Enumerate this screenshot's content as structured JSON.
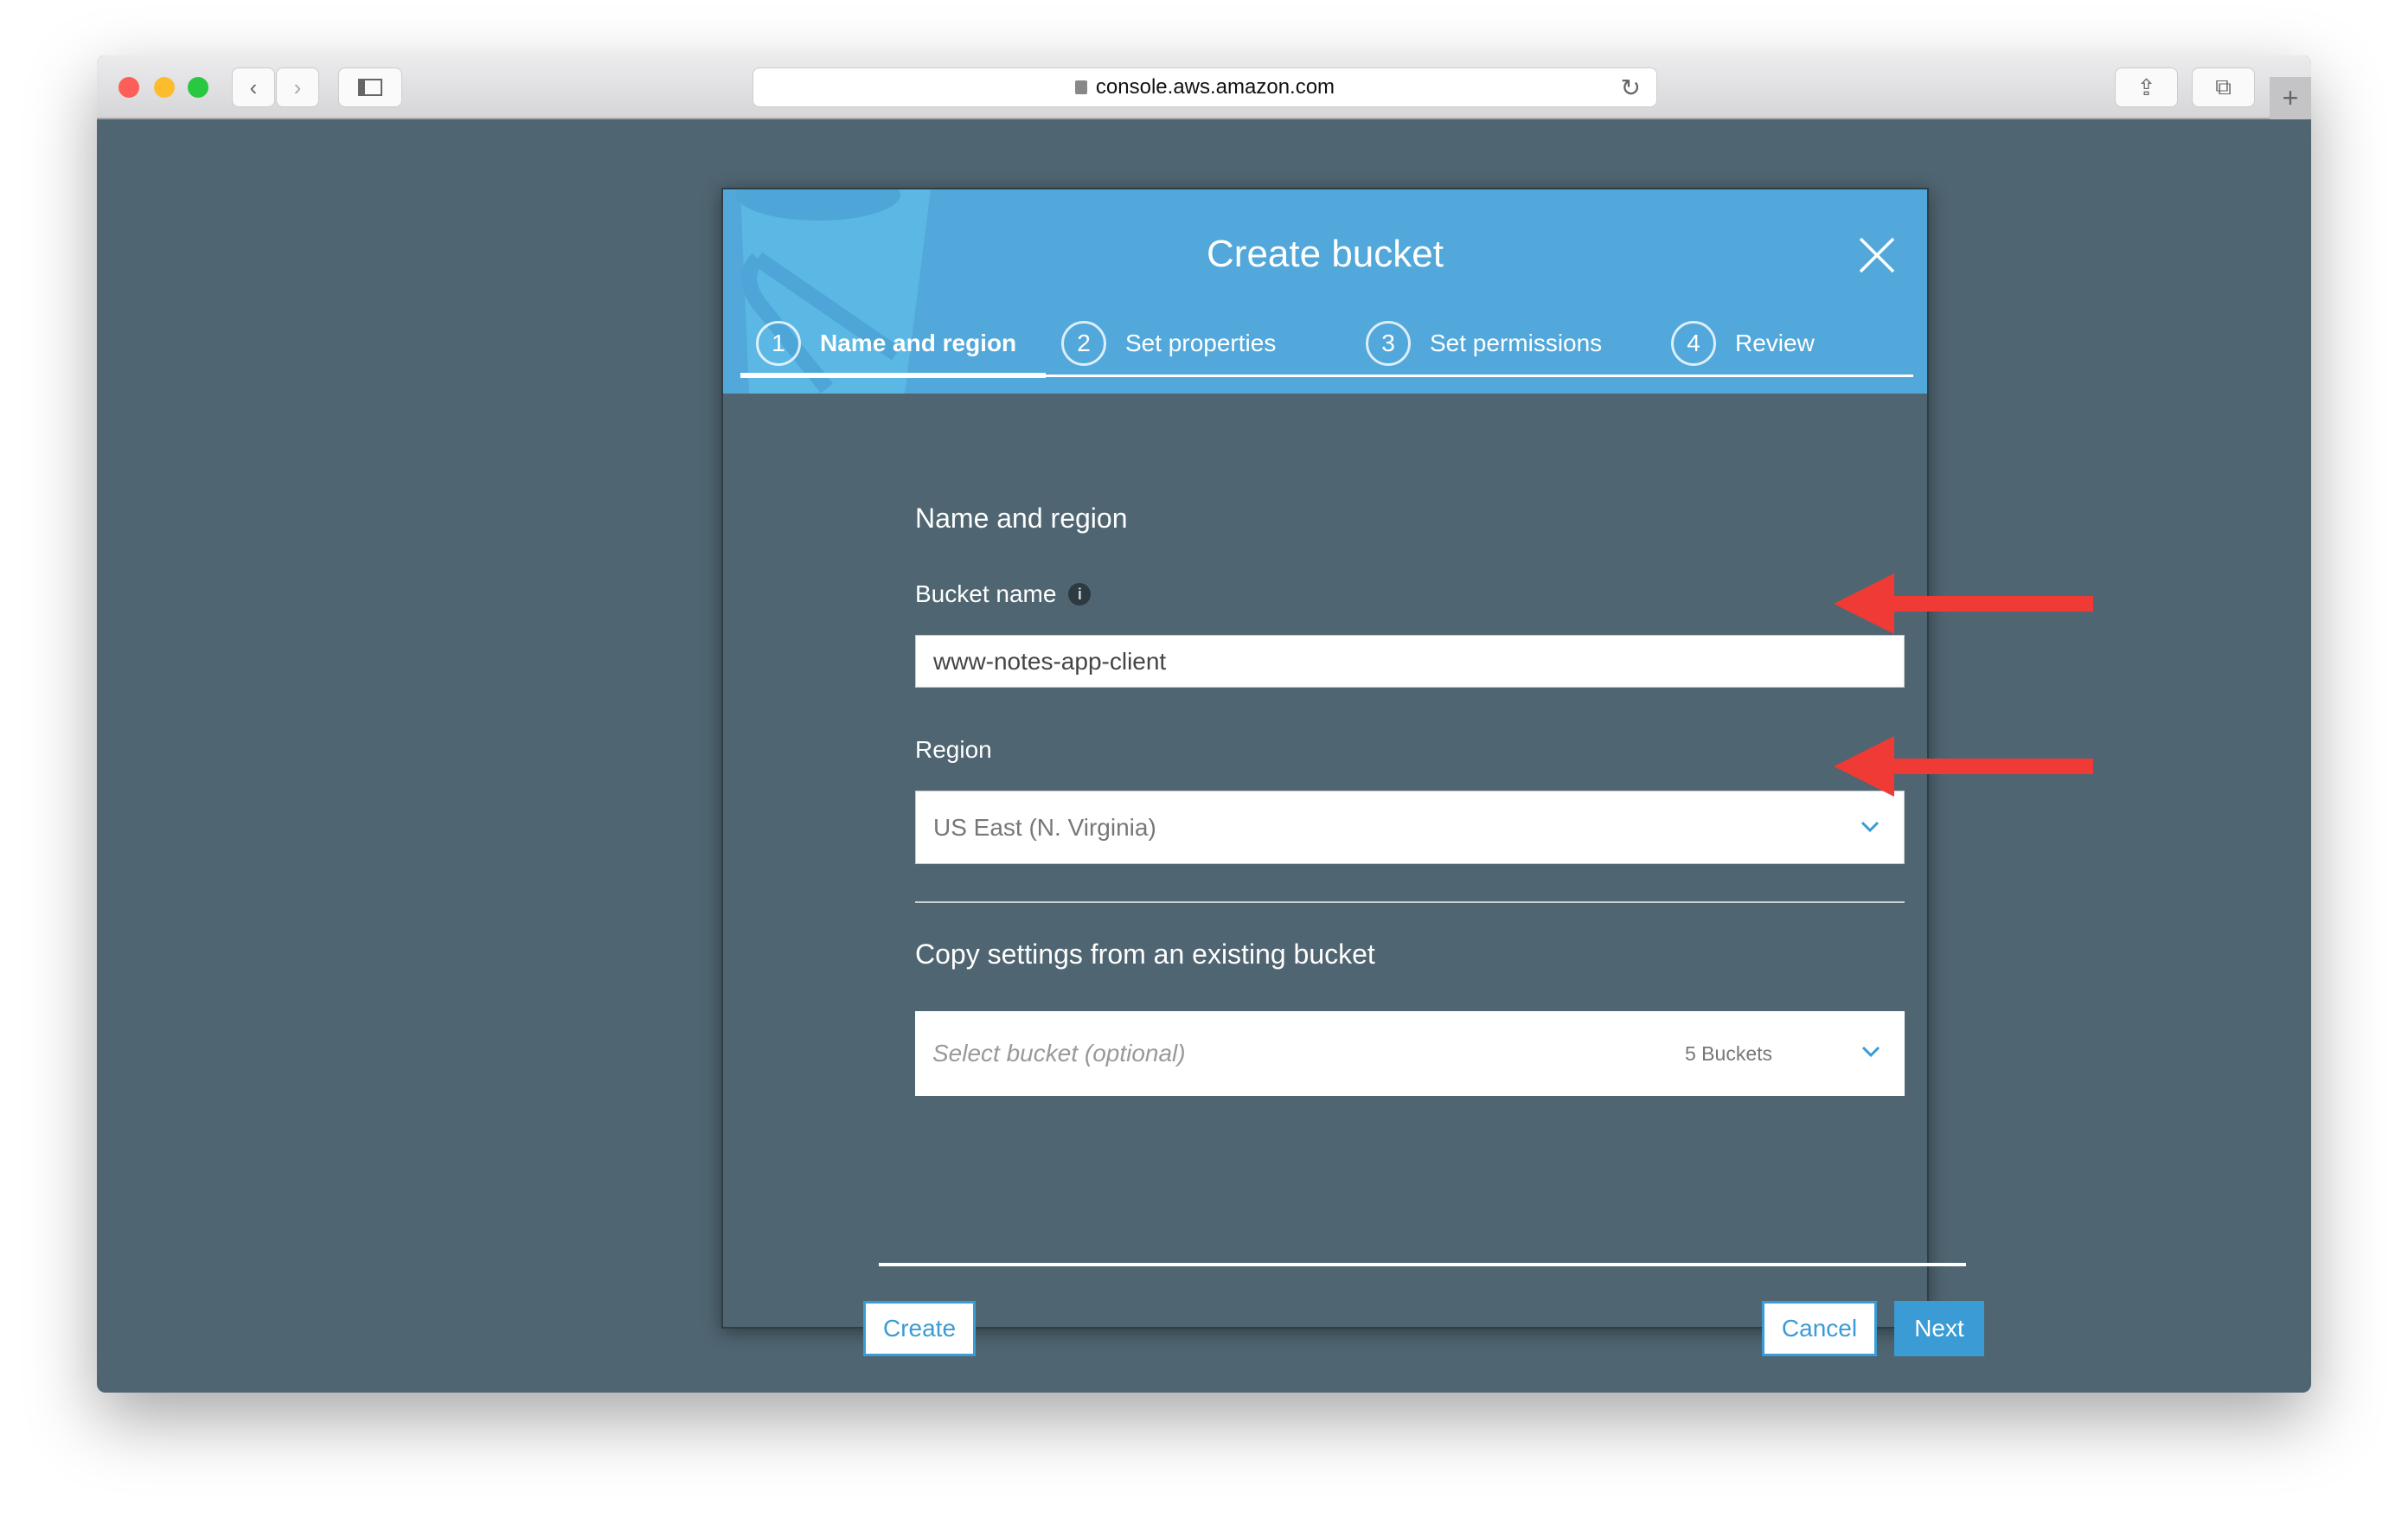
{
  "browser": {
    "url": "console.aws.amazon.com"
  },
  "modal": {
    "title": "Create bucket",
    "steps": [
      {
        "num": "1",
        "label": "Name and region",
        "active": true
      },
      {
        "num": "2",
        "label": "Set properties"
      },
      {
        "num": "3",
        "label": "Set permissions"
      },
      {
        "num": "4",
        "label": "Review"
      }
    ],
    "section_title": "Name and region",
    "bucket_name_label": "Bucket name",
    "bucket_name_value": "www-notes-app-client",
    "region_label": "Region",
    "region_value": "US East (N. Virginia)",
    "copy_title": "Copy settings from an existing bucket",
    "copy_placeholder": "Select bucket (optional)",
    "copy_count": "5 Buckets",
    "create_label": "Create",
    "cancel_label": "Cancel",
    "next_label": "Next"
  },
  "colors": {
    "header": "#52a8da",
    "accent": "#3a9bd5",
    "arrow": "#f03a35",
    "overlay": "#4f6571"
  }
}
